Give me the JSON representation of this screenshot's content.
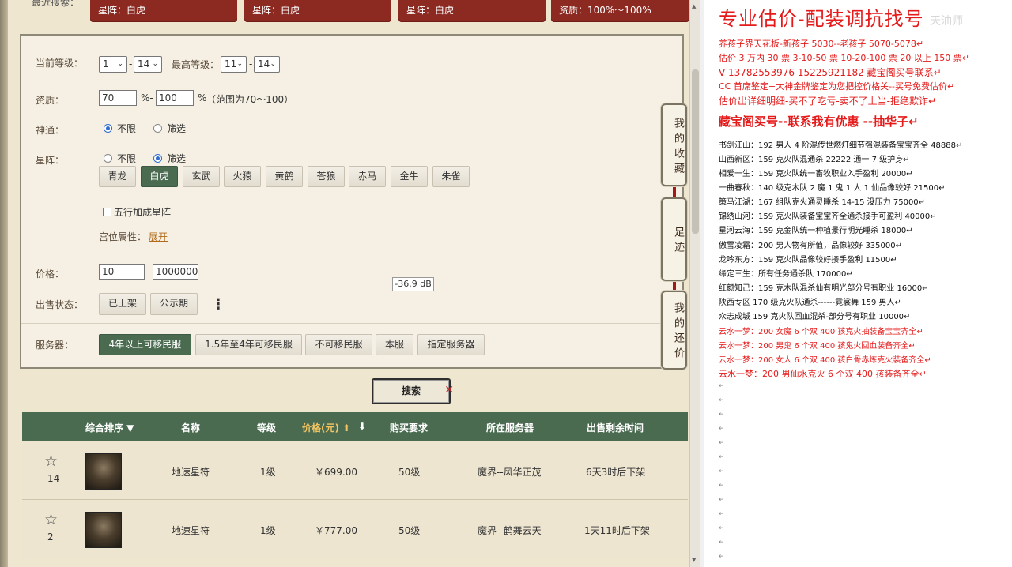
{
  "recent": {
    "label": "最近搜索：",
    "tags": [
      "星阵：白虎",
      "星阵：白虎",
      "星阵：白虎",
      "资质：100%～100%"
    ]
  },
  "filter": {
    "level": {
      "label": "当前等级：",
      "from": "1",
      "to": "14",
      "max_label": "最高等级：",
      "max_from": "11",
      "max_to": "14"
    },
    "aptitude": {
      "label": "资质：",
      "min": "70",
      "max": "100",
      "unit": "%",
      "hint": "（范围为70～100）"
    },
    "shentong": {
      "label": "神通：",
      "opt_any": "不限",
      "opt_filter": "筛选"
    },
    "xingzhen": {
      "label": "星阵：",
      "opt_any": "不限",
      "opt_filter": "筛选",
      "chips": [
        "青龙",
        "白虎",
        "玄武",
        "火猿",
        "黄鹤",
        "苍狼",
        "赤马",
        "金牛",
        "朱雀"
      ],
      "selected": "白虎",
      "wuxing_label": "五行加成星阵",
      "gongwei_label": "宫位属性：",
      "gongwei_link": "展开"
    },
    "price": {
      "label": "价格：",
      "min": "10",
      "max": "1000000"
    },
    "sale_status": {
      "label": "出售状态：",
      "options": [
        "已上架",
        "公示期"
      ],
      "more_icon": "⋮"
    },
    "server": {
      "label": "服务器：",
      "options": [
        "4年以上可移民服",
        "1.5年至4年可移民服",
        "不可移民服",
        "本服",
        "指定服务器"
      ],
      "selected": "4年以上可移民服"
    }
  },
  "side_tabs": [
    "我的收藏",
    "足迹",
    "我的还价"
  ],
  "search_button": "搜索",
  "tooltip": "-36.9 dB",
  "results": {
    "headers": {
      "sort": "综合排序 ▼",
      "name": "名称",
      "level": "等级",
      "price": "价格(元) ⬆",
      "price_down": "⬇",
      "req": "购买要求",
      "server": "所在服务器",
      "time": "出售剩余时间"
    },
    "rows": [
      {
        "count": "14",
        "name": "地速星符",
        "level": "1级",
        "price": "￥699.00",
        "req": "50级",
        "server": "魔界--风华正茂",
        "time": "6天3时后下架"
      },
      {
        "count": "2",
        "name": "地速星符",
        "level": "1级",
        "price": "￥777.00",
        "req": "50级",
        "server": "魔界--鹤舞云天",
        "time": "1天11时后下架"
      }
    ]
  },
  "doc": {
    "title": "专业估价-配装调抗找号",
    "logo": "天油师",
    "lines_red": [
      "养孩子界天花板-新孩子 5030--老孩子 5070-5078↵",
      "估价 3 万内 30 票    3-10-50 票    10-20-100 票    20 以上 150 票↵",
      "V 13782553976     15225921182    藏宝阁买号联系↵",
      "CC 首席鉴定+大神金牌鉴定为您把控价格关--买号免费估价↵",
      "估价出详细明细-买不了吃亏-卖不了上当-拒绝欺诈↵"
    ],
    "heading2": "藏宝阁买号--联系我有优惠 --抽华子↵",
    "lines_black": [
      "书剑江山：192 男人 4 阶混传世燃灯细节强混装备宝宝齐全 48888↵",
      "山西新区：159 克火队混通杀 22222 通一 7 级护身↵",
      "相爱一生：159 克火队统一畜牧职业入手盈利 20000↵",
      "一曲春秋：140 级克木队 2 魔 1 鬼 1 人 1 仙品像较好 21500↵",
      "策马江湖：167 组队克火通灵睡杀 14-15 没压力 75000↵",
      "锦绣山河：159 克火队装备宝宝齐全通杀接手可盈利 40000↵",
      "星河云海：159 克金队统一种植景行明光睡杀 18000↵",
      "傲雪凌霜：200 男人物有所值，品像较好 335000↵",
      "龙吟东方：159 克火队品像较好接手盈利 11500↵",
      "缘定三生：所有任务通杀队 170000↵",
      "红颜知己：159 克木队混杀仙有明光部分号有职业 16000↵",
      "陕西专区 170 级克火队通杀------霓裳舞 159 男人↵",
      "众志成城 159 克火队回血混杀-部分号有职业 10000↵"
    ],
    "lines_red_small": [
      "云水一梦：200 女魔 6 个双 400 孩克火抽装备宝宝齐全↵",
      "云水一梦：200 男鬼 6 个双 400 孩鬼火回血装备齐全↵",
      "云水一梦：200 女人 6 个双 400 孩白骨赤炼克火装备齐全↵",
      "云水一梦：200 男仙水克火 6 个双 400 孩装备齐全↵"
    ],
    "para_mark": "↵"
  }
}
